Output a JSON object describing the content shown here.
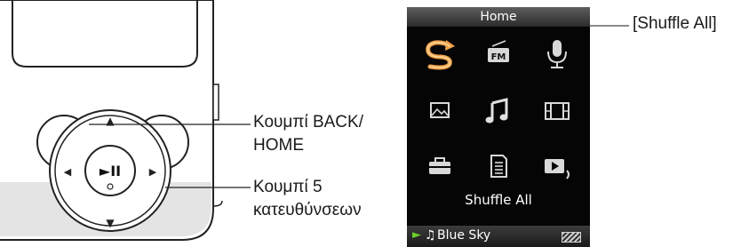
{
  "device_callouts": {
    "back_home": {
      "line1": "Κουμπί BACK/",
      "line2": "HOME"
    },
    "five_way": {
      "line1": "Κουμπί 5",
      "line2": "κατευθύνσεων"
    }
  },
  "device_buttons": {
    "up_arrow": "▲",
    "down_arrow": "▼",
    "left_arrow": "◀",
    "right_arrow": "▶",
    "center_label": "►II"
  },
  "screen": {
    "title": "Home",
    "selected_item": "Shuffle All",
    "icons": [
      "shuffle-all-icon",
      "fm-radio-icon",
      "voice-recording-icon",
      "photo-icon",
      "music-icon",
      "video-icon",
      "settings-icon",
      "playlist-icon",
      "now-playing-icon"
    ],
    "status": {
      "track": "Blue Sky",
      "play_glyph": "►",
      "note_glyph": "♫"
    },
    "accent": "#f0a24a"
  },
  "screen_callout": "[Shuffle All]"
}
